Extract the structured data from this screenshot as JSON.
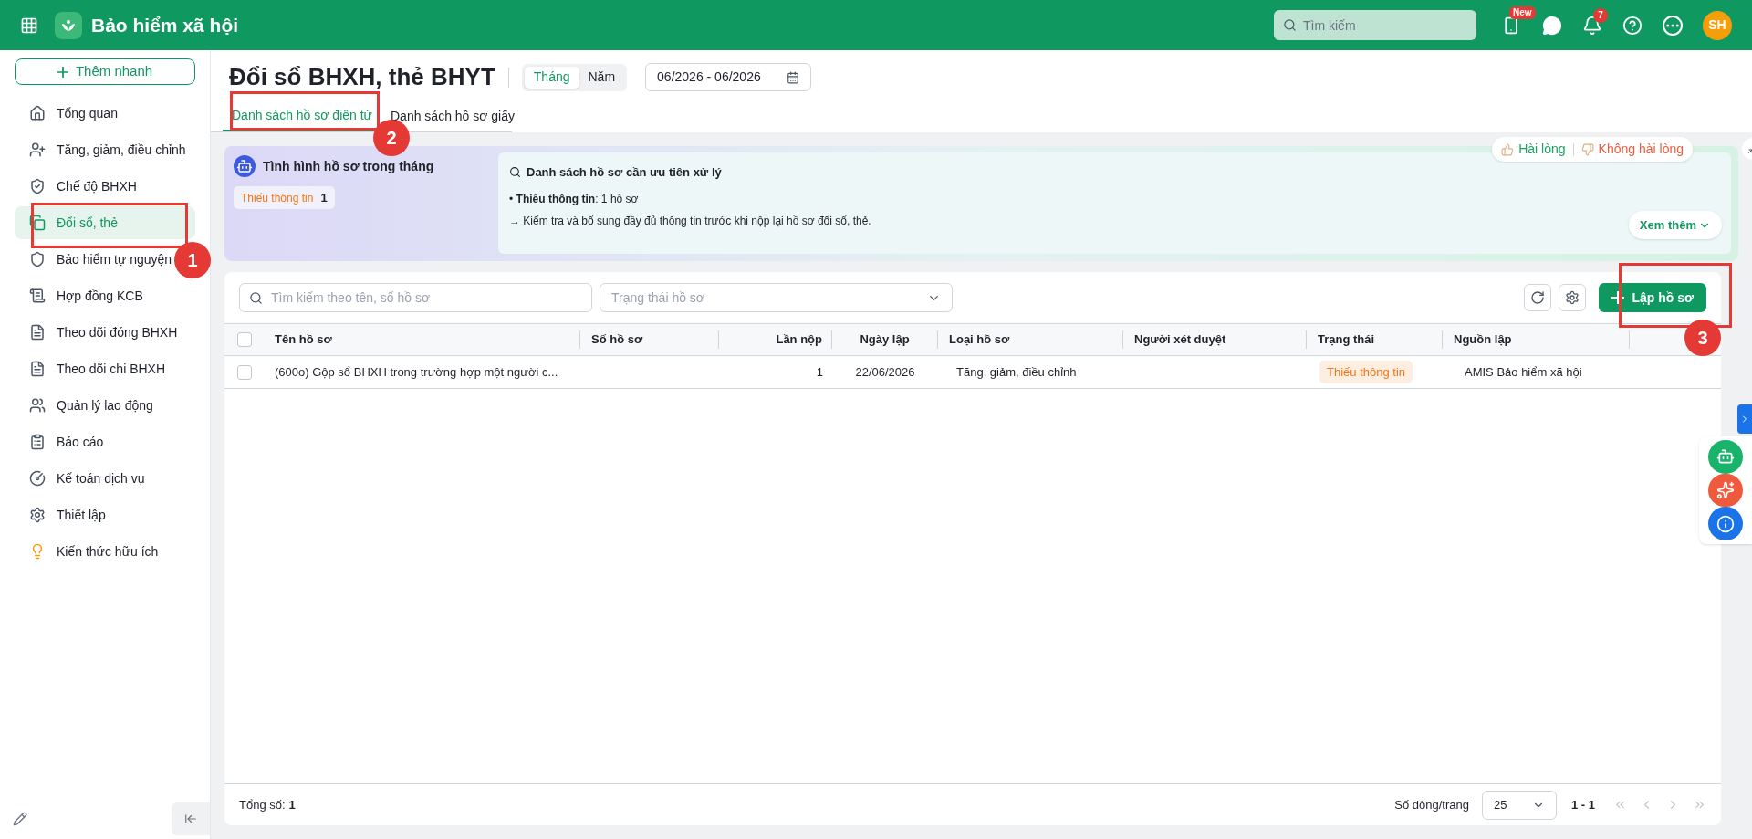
{
  "app": {
    "title": "Bảo hiểm xã hội"
  },
  "topbar": {
    "search": {
      "placeholder": "Tìm kiếm"
    },
    "new_badge": "New",
    "notification_count": "7",
    "avatar": "SH"
  },
  "sidebar": {
    "quick_add": "Thêm nhanh",
    "items": [
      {
        "label": "Tổng quan",
        "selected": false
      },
      {
        "label": "Tăng, giảm, điều chỉnh",
        "selected": false
      },
      {
        "label": "Chế độ BHXH",
        "selected": false
      },
      {
        "label": "Đổi sổ, thẻ",
        "selected": true
      },
      {
        "label": "Bảo hiểm tự nguyện",
        "selected": false
      },
      {
        "label": "Hợp đồng KCB",
        "selected": false
      },
      {
        "label": "Theo dõi đóng BHXH",
        "selected": false
      },
      {
        "label": "Theo dõi chi BHXH",
        "selected": false
      },
      {
        "label": "Quản lý lao động",
        "selected": false
      },
      {
        "label": "Báo cáo",
        "selected": false
      },
      {
        "label": "Kế toán dịch vụ",
        "selected": false
      },
      {
        "label": "Thiết lập",
        "selected": false
      },
      {
        "label": "Kiến thức hữu ích",
        "selected": false
      }
    ]
  },
  "page": {
    "title": "Đổi sổ BHXH, thẻ BHYT",
    "period_toggle": [
      {
        "label": "Tháng",
        "selected": true
      },
      {
        "label": "Năm",
        "selected": false
      }
    ],
    "date_range": "06/2026 - 06/2026",
    "tabs": [
      {
        "label": "Danh sách hồ sơ điện tử",
        "selected": true
      },
      {
        "label": "Danh sách hồ sơ giấy",
        "selected": false
      }
    ]
  },
  "summary": {
    "title": "Tình hình hồ sơ trong tháng",
    "status_chip": {
      "label": "Thiếu thông tin",
      "count": "1"
    },
    "priority": {
      "title": "Danh sách hồ sơ cần ưu tiên xử lý",
      "line_1": "• **Thiếu thông tin**: 1 hồ sơ",
      "line_2": "→ Kiểm tra và bổ sung đầy đủ thông tin trước khi nộp lại hồ sơ đổi sổ, thẻ.",
      "more": "Xem thêm"
    },
    "feedback": {
      "like": "Hài lòng",
      "dislike": "Không hài lòng"
    }
  },
  "list": {
    "search": {
      "placeholder": "Tìm kiếm theo tên, số hồ sơ"
    },
    "status_filter": {
      "placeholder": "Trạng thái hồ sơ"
    },
    "create_button": "Lập hồ sơ",
    "select_all_checked": false,
    "columns": [
      "Tên hồ sơ",
      "Số hồ sơ",
      "Lần nộp",
      "Ngày lập",
      "Loại hồ sơ",
      "Người xét duyệt",
      "Trạng thái",
      "Nguồn lập"
    ],
    "rows": [
      {
        "checked": false,
        "name": "(600o) Gộp sổ BHXH trong trường hợp một người c...",
        "submissions": "1",
        "date": "22/06/2026",
        "type": "Tăng, giảm, điều chỉnh",
        "status": "Thiếu thông tin",
        "source": "AMIS Bảo hiểm xã hội"
      }
    ],
    "total_label": "Tổng số:",
    "total": "1",
    "page_size_label": "Số dòng/trang",
    "page_size": "25",
    "range": "1 - 1"
  },
  "annotations": [
    {
      "label": "1"
    },
    {
      "label": "2"
    },
    {
      "label": "3"
    }
  ]
}
